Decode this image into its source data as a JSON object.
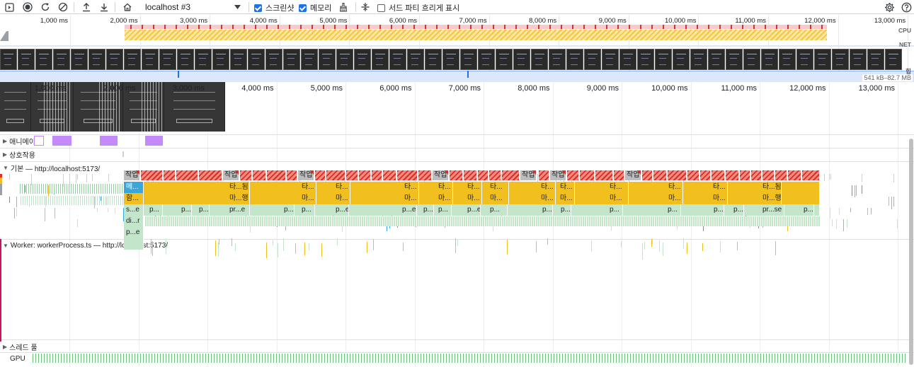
{
  "toolbar": {
    "recording_name": "localhost #3",
    "screenshots_label": "스크린샷",
    "screenshots_checked": true,
    "memory_label": "메모리",
    "memory_checked": true,
    "third_party_label": "서드 파티 흐리게 표시",
    "third_party_checked": false,
    "icons": [
      "sidebar-toggle-icon",
      "record-icon",
      "reload-icon",
      "clear-icon",
      "upload-icon",
      "download-icon",
      "home-icon",
      "cleanup-icon",
      "expand-collapse-icon",
      "settings-icon",
      "help-icon"
    ]
  },
  "overview": {
    "ticks": [
      "1,000 ms",
      "2,000 ms",
      "3,000 ms",
      "4,000 ms",
      "5,000 ms",
      "6,000 ms",
      "7,000 ms",
      "8,000 ms",
      "9,000 ms",
      "10,000 ms",
      "11,000 ms",
      "12,000 ms",
      "13,000 ms"
    ],
    "cpu_label": "CPU",
    "net_label": "NET",
    "heap_label": "힙",
    "memory_range": "541 kB–82.7 MB"
  },
  "timeline": {
    "ticks": [
      "1,000 ms",
      "2,000 ms",
      "3,000 ms",
      "4,000 ms",
      "5,000 ms",
      "6,000 ms",
      "7,000 ms",
      "8,000 ms",
      "9,000 ms",
      "10,000 ms",
      "11,000 ms",
      "12,000 ms",
      "13,000 ms"
    ]
  },
  "tracks": {
    "animations": "애니메이션",
    "interactions": "상호작용",
    "main": "기본 — http://localhost:5173/",
    "worker": "Worker: workerProcess.ts — http://localhost:5173/",
    "thread_pool": "스레드 풀",
    "gpu": "GPU"
  },
  "worker": {
    "task_label": "작업",
    "row2": [
      {
        "t": "메...",
        "c": "blue"
      },
      {
        "t": "타...됨",
        "c": "yel"
      },
      {
        "t": "타...",
        "c": "yel"
      },
      {
        "t": "타...",
        "c": "yel"
      },
      {
        "t": "타...",
        "c": "yel"
      },
      {
        "t": "타...",
        "c": "yel"
      },
      {
        "t": "타...",
        "c": "yel"
      },
      {
        "t": "타...",
        "c": "yel"
      },
      {
        "t": "타...",
        "c": "yel"
      },
      {
        "t": "타...",
        "c": "yel"
      },
      {
        "t": "타...",
        "c": "yel"
      },
      {
        "t": "타...",
        "c": "yel"
      },
      {
        "t": "타...",
        "c": "yel"
      },
      {
        "t": "타...됨",
        "c": "yel"
      }
    ],
    "row3": [
      {
        "t": "함..."
      },
      {
        "t": "마...행"
      },
      {
        "t": "마..."
      },
      {
        "t": "마..."
      },
      {
        "t": "마..."
      },
      {
        "t": "마..."
      },
      {
        "t": "마..."
      },
      {
        "t": "마..."
      },
      {
        "t": "마..."
      },
      {
        "t": "마..."
      },
      {
        "t": "마..."
      },
      {
        "t": "마..."
      },
      {
        "t": "마..."
      },
      {
        "t": "마...행"
      }
    ],
    "row4": [
      {
        "t": "s...e"
      },
      {
        "t": "p..."
      },
      {
        "t": "p..."
      },
      {
        "t": "p..."
      },
      {
        "t": "pr...e"
      },
      {
        "t": "p..."
      },
      {
        "t": "p..."
      },
      {
        "t": "p...e"
      },
      {
        "t": "p...e"
      },
      {
        "t": "p..."
      },
      {
        "t": "p..."
      },
      {
        "t": "p...e"
      },
      {
        "t": "p..."
      },
      {
        "t": "p..."
      },
      {
        "t": "p..."
      },
      {
        "t": "p..."
      },
      {
        "t": "p..."
      },
      {
        "t": "p..."
      },
      {
        "t": "p..."
      },
      {
        "t": "pr...se"
      },
      {
        "t": "p..."
      }
    ],
    "row5": "di...r",
    "row6": "p...e"
  }
}
